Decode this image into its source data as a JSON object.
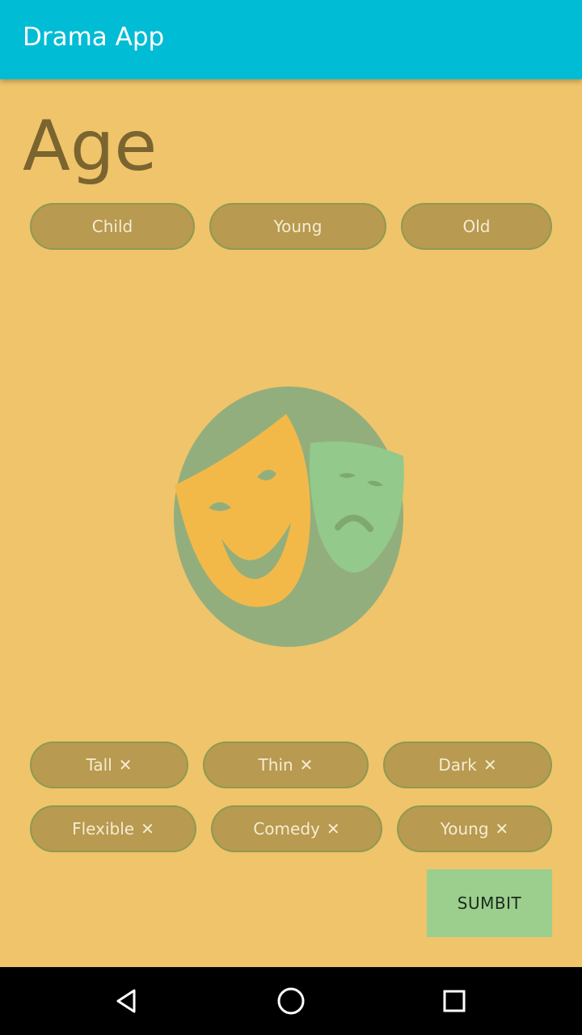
{
  "app": {
    "title": "Drama App"
  },
  "age": {
    "heading": "Age",
    "options": [
      "Child",
      "Young",
      "Old"
    ]
  },
  "logo": {
    "icon": "theater-masks-icon"
  },
  "tags": {
    "remove_icon": "✕",
    "items": [
      "Tall",
      "Thin",
      "Dark",
      "Flexible",
      "Comedy",
      "Young"
    ]
  },
  "actions": {
    "submit_label": "SUMBIT"
  },
  "colors": {
    "appbar": "#00bcd4",
    "background": "#f0c46a",
    "pill": "#b89a50",
    "submit": "#9ccf8e"
  },
  "navbar": {
    "icons": [
      "back-icon",
      "home-icon",
      "recents-icon"
    ]
  }
}
